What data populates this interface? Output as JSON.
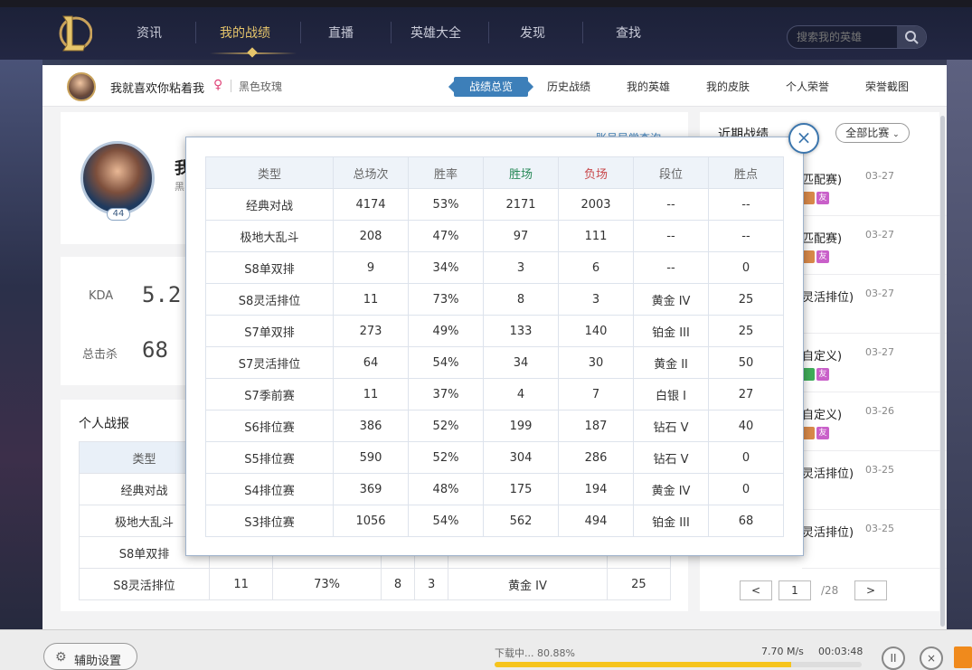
{
  "nav": {
    "items": [
      "资讯",
      "我的战绩",
      "直播",
      "英雄大全",
      "发现",
      "查找"
    ],
    "active_index": 1,
    "search_placeholder": "搜索我的英雄"
  },
  "user": {
    "name": "我就喜欢你粘着我",
    "gender_symbol": "♀",
    "server": "黑色玫瑰"
  },
  "tabs": [
    "战绩总览",
    "历史战绩",
    "我的英雄",
    "我的皮肤",
    "个人荣誉",
    "荣誉截图"
  ],
  "profile": {
    "level": "44",
    "name_partial": "我",
    "sub_partial": "黑",
    "account_link_partial": "账号异常查询"
  },
  "stats": {
    "kda_label": "KDA",
    "kda_value": "5.2",
    "kills_label": "总击杀",
    "kills_value": "68"
  },
  "report": {
    "title": "个人战报",
    "header_type": "类型",
    "rows": [
      {
        "type": "经典对战"
      },
      {
        "type": "极地大乱斗"
      },
      {
        "type": "S8单双排"
      },
      {
        "type": "S8灵活排位",
        "total": "11",
        "rate": "73%",
        "win": "8",
        "lose": "3",
        "rank": "黄金 IV",
        "points": "25"
      }
    ]
  },
  "modal": {
    "headers": [
      "类型",
      "总场次",
      "胜率",
      "胜场",
      "负场",
      "段位",
      "胜点"
    ],
    "rows": [
      [
        "经典对战",
        "4174",
        "53%",
        "2171",
        "2003",
        "--",
        "--"
      ],
      [
        "极地大乱斗",
        "208",
        "47%",
        "97",
        "111",
        "--",
        "--"
      ],
      [
        "S8单双排",
        "9",
        "34%",
        "3",
        "6",
        "--",
        "0"
      ],
      [
        "S8灵活排位",
        "11",
        "73%",
        "8",
        "3",
        "黄金 IV",
        "25"
      ],
      [
        "S7单双排",
        "273",
        "49%",
        "133",
        "140",
        "铂金 III",
        "25"
      ],
      [
        "S7灵活排位",
        "64",
        "54%",
        "34",
        "30",
        "黄金 II",
        "50"
      ],
      [
        "S7季前赛",
        "11",
        "37%",
        "4",
        "7",
        "白银 I",
        "27"
      ],
      [
        "S6排位赛",
        "386",
        "52%",
        "199",
        "187",
        "钻石 V",
        "40"
      ],
      [
        "S5排位赛",
        "590",
        "52%",
        "304",
        "286",
        "钻石 V",
        "0"
      ],
      [
        "S4排位赛",
        "369",
        "48%",
        "175",
        "194",
        "黄金 IV",
        "0"
      ],
      [
        "S3排位赛",
        "1056",
        "54%",
        "562",
        "494",
        "铂金 III",
        "68"
      ]
    ],
    "close_symbol": "×"
  },
  "recent": {
    "title": "近期战绩",
    "filter": "全部比赛",
    "matches": [
      {
        "type": "匹配赛)",
        "date": "03-27",
        "badge": "友"
      },
      {
        "type": "匹配赛)",
        "date": "03-27",
        "badge": "友"
      },
      {
        "type": "灵活排位)",
        "date": "03-27",
        "badge": ""
      },
      {
        "type": "自定义)",
        "date": "03-27",
        "badge": "友"
      },
      {
        "type": "自定义)",
        "date": "03-26",
        "badge": "友"
      },
      {
        "type": "灵活排位)",
        "date": "03-25",
        "badge": ""
      },
      {
        "type": "灵活排位)",
        "date": "03-25",
        "badge": ""
      }
    ],
    "page_current": "1",
    "page_total": "/28",
    "prev": "<",
    "next": ">"
  },
  "footer": {
    "assist_label": "辅助设置",
    "download_text": "下载中... 80.88%",
    "download_progress": 0.8088,
    "speed": "7.70 M/s",
    "time": "00:03:48",
    "pause_symbol": "II",
    "close_symbol": "×"
  },
  "colors": {
    "accent": "#3d7fb9",
    "gold": "#e6c56b",
    "progress": "#f6c41c"
  }
}
